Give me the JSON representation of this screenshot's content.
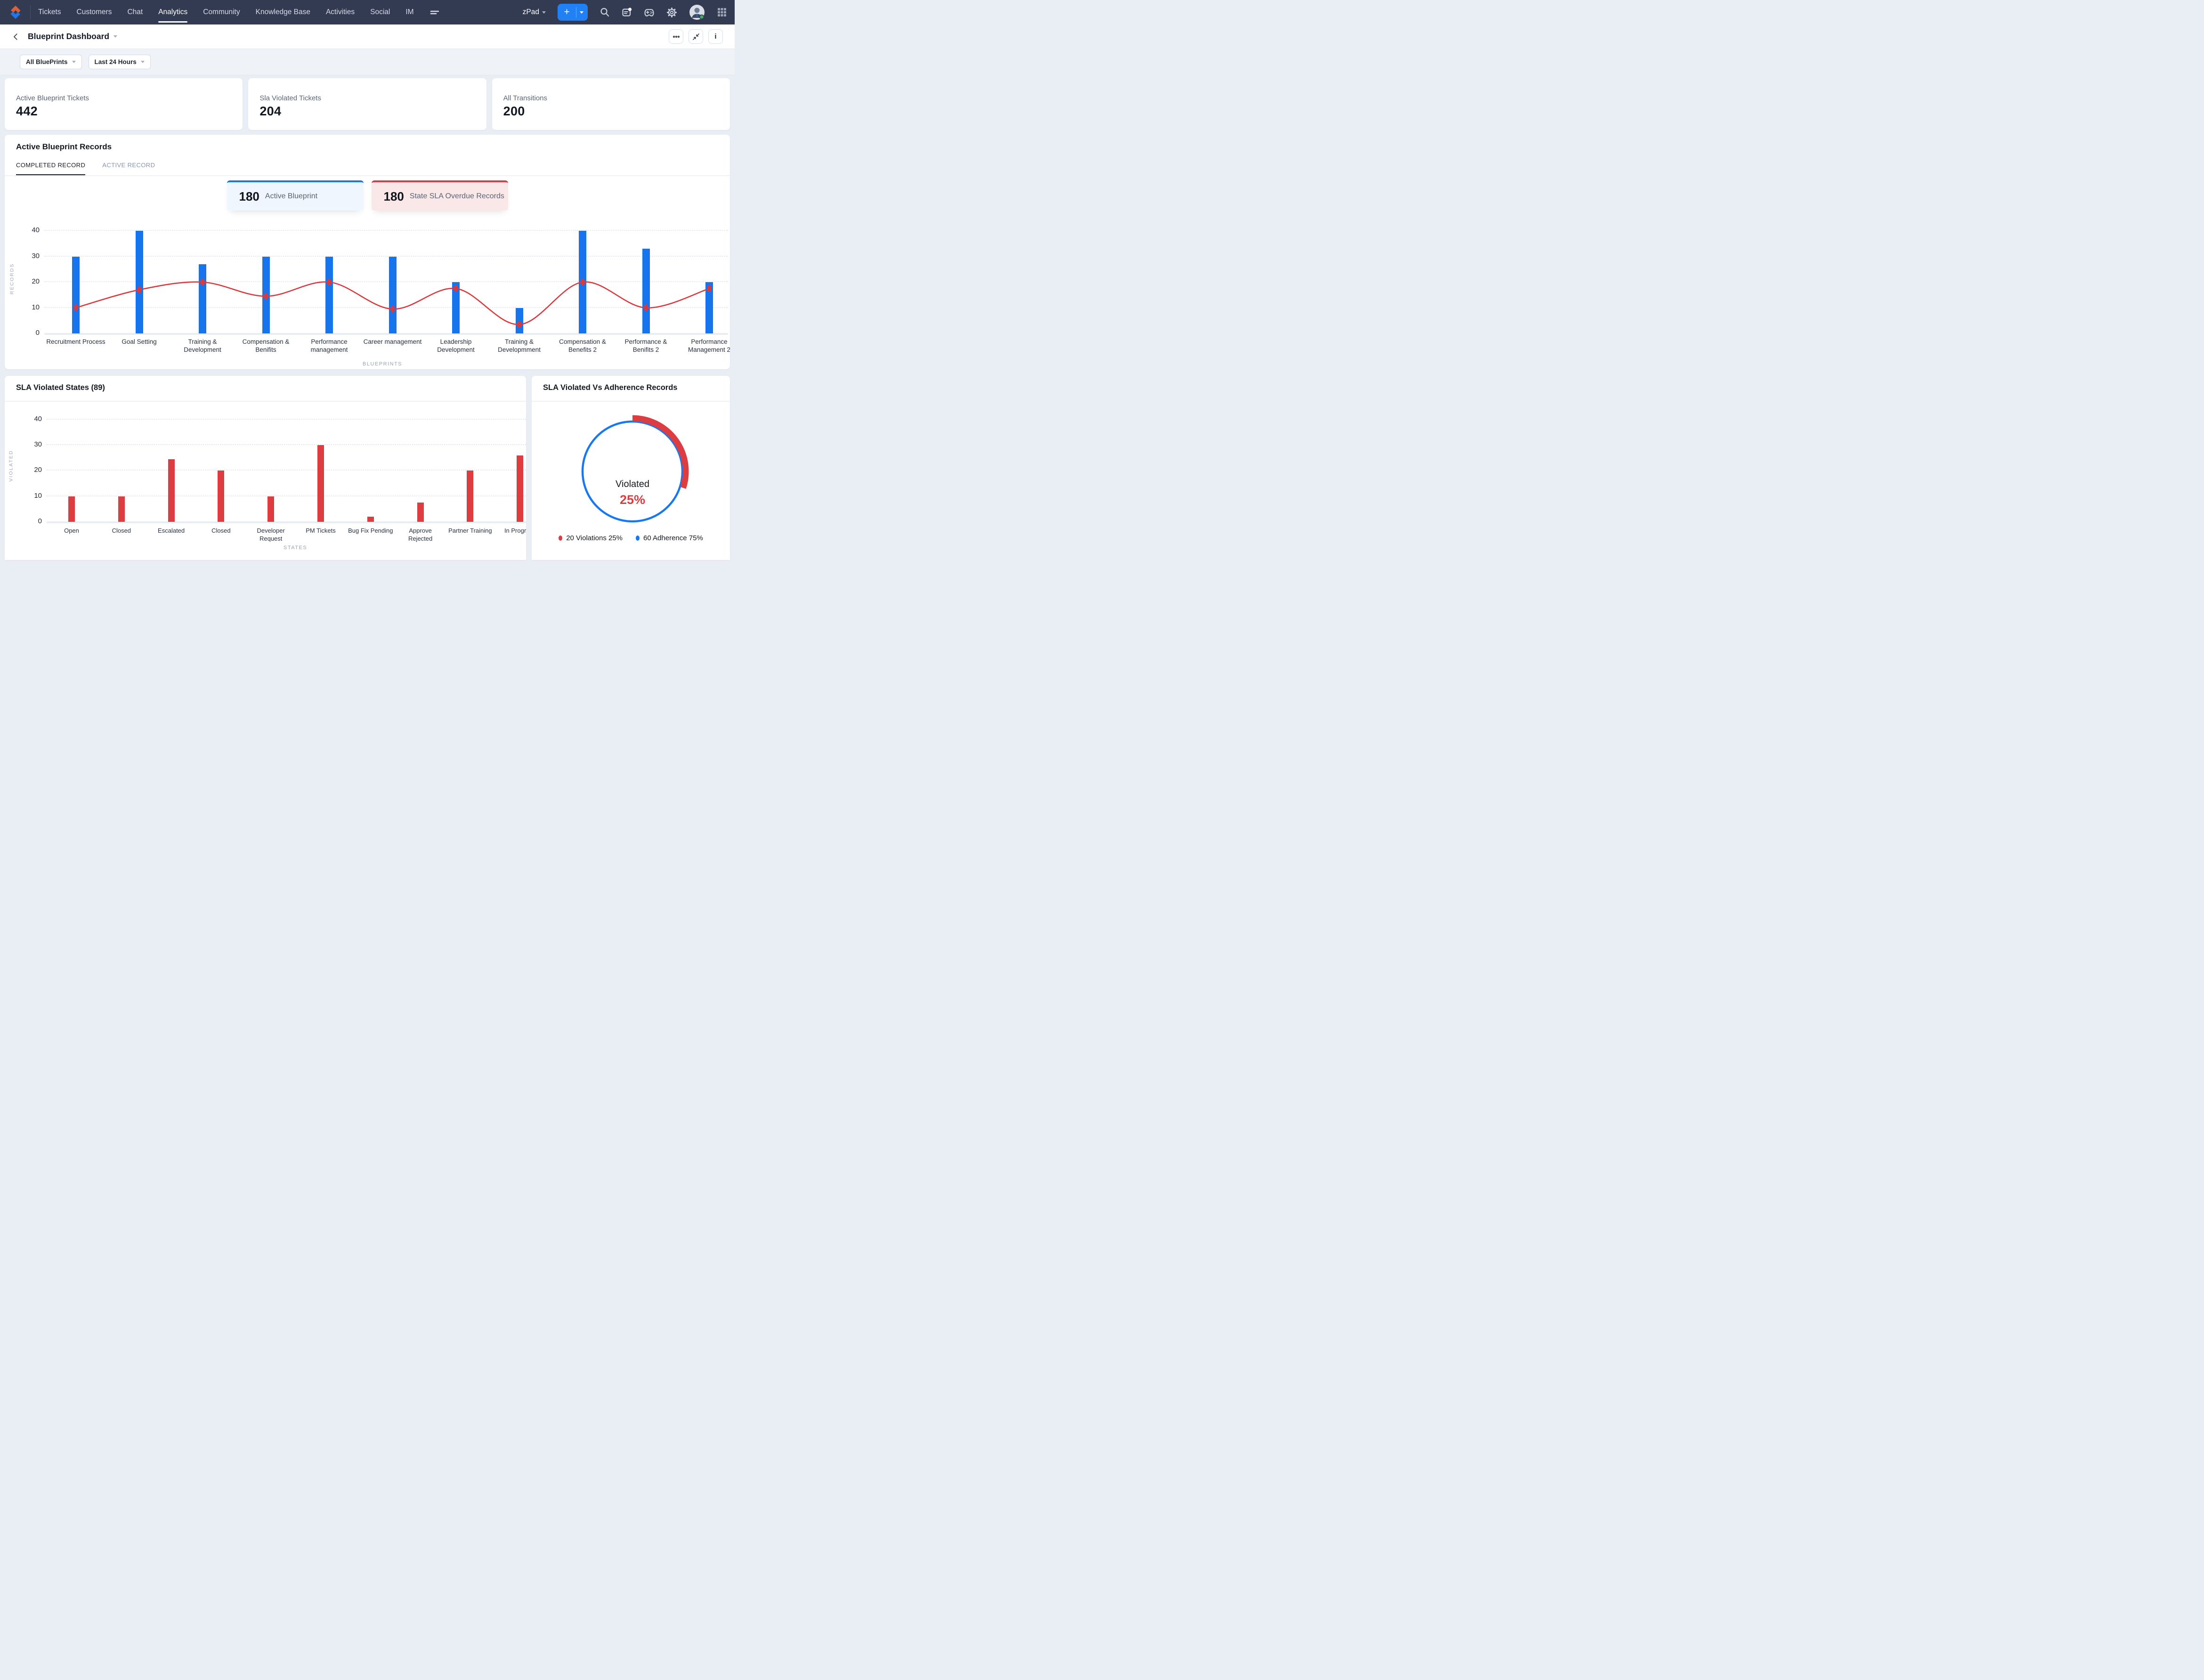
{
  "nav": {
    "items": [
      {
        "label": "Tickets",
        "active": false
      },
      {
        "label": "Customers",
        "active": false
      },
      {
        "label": "Chat",
        "active": false
      },
      {
        "label": "Analytics",
        "active": true
      },
      {
        "label": "Community",
        "active": false
      },
      {
        "label": "Knowledge Base",
        "active": false
      },
      {
        "label": "Activities",
        "active": false
      },
      {
        "label": "Social",
        "active": false
      },
      {
        "label": "IM",
        "active": false
      }
    ],
    "workspace": "zPad",
    "add_label": "+"
  },
  "header": {
    "title": "Blueprint Dashboard"
  },
  "filters": {
    "blueprint": "All BluePrints",
    "time_range": "Last 24 Hours"
  },
  "stat_cards": [
    {
      "label": "Active Blueprint Tickets",
      "value": "442"
    },
    {
      "label": "Sla Violated Tickets",
      "value": "204"
    },
    {
      "label": "All Transitions",
      "value": "200"
    }
  ],
  "records_section": {
    "title": "Active Blueprint Records",
    "tabs": [
      {
        "label": "COMPLETED RECORD",
        "active": true
      },
      {
        "label": "ACTIVE RECORD",
        "active": false
      }
    ],
    "chips": [
      {
        "value": "180",
        "label": "Active Blueprint",
        "theme": "blue"
      },
      {
        "value": "180",
        "label": "State SLA Overdue Records",
        "theme": "red"
      }
    ]
  },
  "chart_data": [
    {
      "id": "active-blueprint-records",
      "type": "bar",
      "title": "Active Blueprint Records",
      "categories": [
        "Recruitment Process",
        "Goal Setting",
        "Training & Development",
        "Compensation & Benifits",
        "Performance management",
        "Career management",
        "Leadership Development",
        "Training & Developmment",
        "Compensation & Benefits 2",
        "Performance & Benifits 2",
        "Performance Management 2"
      ],
      "series": [
        {
          "name": "records",
          "type": "bar",
          "color": "#1674EC",
          "values": [
            30,
            40,
            27,
            30,
            30,
            30,
            20,
            10,
            40,
            33,
            20
          ]
        },
        {
          "name": "trend",
          "type": "line",
          "color": "#D93A3F",
          "values": [
            10,
            17,
            20,
            14.5,
            20,
            9.5,
            17.5,
            3.5,
            20,
            10,
            17.5
          ]
        }
      ],
      "xlabel": "BLUEPRINTS",
      "ylabel": "RECORDS",
      "yticks": [
        40,
        30,
        20,
        10,
        0
      ],
      "ylim": [
        0,
        44
      ],
      "grid": true,
      "legend_position": "none"
    },
    {
      "id": "sla-violated-states",
      "type": "bar",
      "title": "SLA Violated States (89)",
      "categories": [
        "Open",
        "Closed",
        "Escalated",
        "Closed",
        "Developer Request",
        "PM Tickets",
        "Bug Fix Pending",
        "Approve Rejected",
        "Partner Training",
        "In Progress"
      ],
      "values": [
        10,
        10,
        24.5,
        20,
        10,
        30,
        2,
        7.5,
        20,
        26
      ],
      "color": "#DD3C41",
      "xlabel": "STATES",
      "ylabel": "VIOLATED",
      "yticks": [
        40,
        30,
        20,
        10,
        0
      ],
      "ylim": [
        0,
        44
      ],
      "grid": true,
      "legend_position": "none"
    },
    {
      "id": "sla-violated-vs-adherence",
      "type": "pie",
      "title": "SLA Violated Vs Adherence Records",
      "center_label": "Violated",
      "center_value": "25%",
      "slices": [
        {
          "name": "Violations",
          "count": 20,
          "pct": 25,
          "color": "#DD3C41"
        },
        {
          "name": "Adherence",
          "count": 60,
          "pct": 75,
          "color": "#1778F2"
        }
      ],
      "legend": [
        {
          "label": "20 Violations 25%",
          "color": "#DD3C41"
        },
        {
          "label": "60 Adherence 75%",
          "color": "#1778F2"
        }
      ]
    }
  ]
}
